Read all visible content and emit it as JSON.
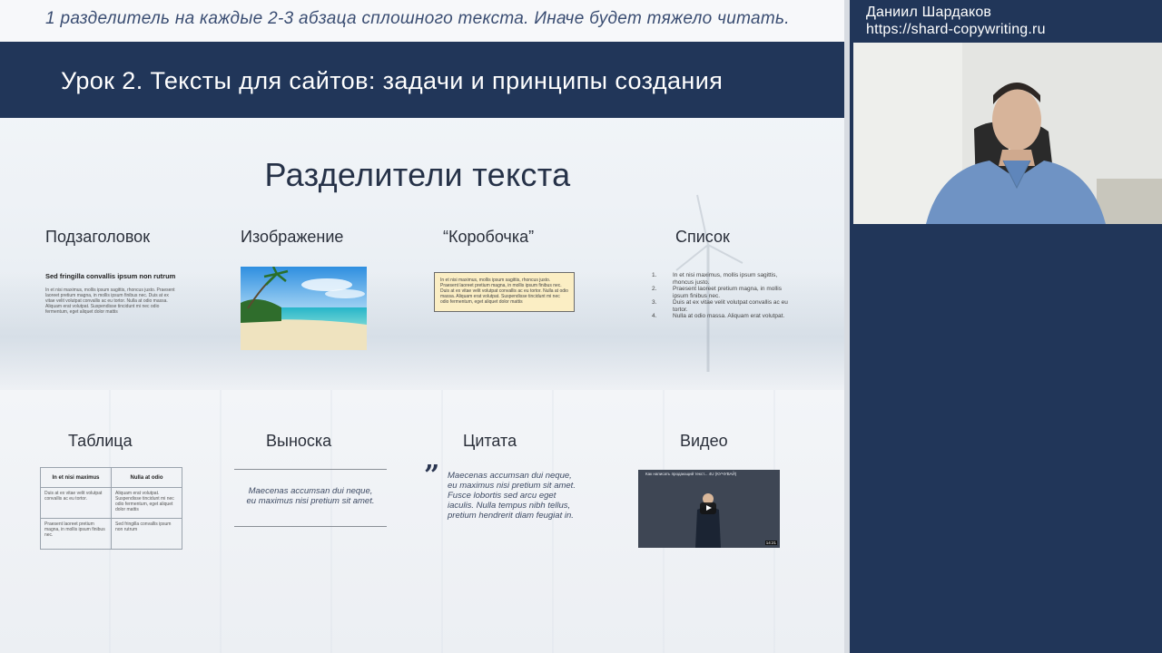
{
  "slide": {
    "top_note": "1 разделитель на каждые 2-3 абзаца сплошного текста. Иначе будет тяжело читать.",
    "lesson_title": "Урок 2. Тексты для сайтов: задачи и принципы создания",
    "heading": "Разделители текста",
    "labels": {
      "subheading": "Подзаголовок",
      "image": "Изображение",
      "box": "“Коробочка”",
      "list": "Список",
      "table": "Таблица",
      "callout": "Выноска",
      "quote": "Цитата",
      "video": "Видео"
    },
    "subheading_sample": {
      "title": "Sed fringilla convallis ipsum non rutrum",
      "body": "In et nisi maximus, mollis ipsum sagittis, rhoncus justo. Praesent laoreet pretium magna, in mollis ipsum finibus nec. Duis at ex vitae velit volutpat convallis ac eu tortor. Nulla at odio massa. Aliquam erat volutpat. Suspendisse tincidunt mi nec odio fermentum, eget aliquet dolor mattis"
    },
    "box_sample": {
      "text": "In et nisi maximus, mollis ipsum sagittis, rhoncus justo. Praesent laoreet pretium magna, in mollis ipsum finibus nec. Duis at ex vitae velit volutpat convallis ac eu tortor. Nulla at odio massa. Aliquam erat volutpat. Suspendisse tincidunt mi nec odio fermentum, eget aliquet dolor mattis"
    },
    "list_sample": [
      {
        "num": "1.",
        "text": "In et nisi maximus, mollis ipsum sagittis, rhoncus justo."
      },
      {
        "num": "2.",
        "text": "Praesent laoreet pretium magna, in mollis ipsum finibus nec."
      },
      {
        "num": "3.",
        "text": "Duis at ex vitae velit volutpat convallis ac eu tortor."
      },
      {
        "num": "4.",
        "text": "Nulla at odio massa. Aliquam erat volutpat."
      }
    ],
    "table_sample": {
      "headers": [
        "In et nisi maximus",
        "Nulla at odio"
      ],
      "rows": [
        [
          "Duis at ex vitae velit volutpat convallis ac eu tortor.",
          "Aliquam erat volutpat. Suspendisse tincidunt mi nec odio fermentum, eget aliquet dolor mattis"
        ],
        [
          "Praesent laoreet pretium magna, in mollis ipsum finibus nec.",
          "Sed fringilla convallis ipsum non rutrum"
        ]
      ]
    },
    "callout_sample": {
      "line1": "Maecenas accumsan dui neque,",
      "line2": "eu maximus nisi pretium sit amet."
    },
    "quote_sample": {
      "mark": "”",
      "lines": [
        "Maecenas accumsan dui neque,",
        "eu maximus nisi pretium sit amet.",
        "Fusce lobortis sed arcu eget",
        "iaculis. Nulla tempus nibh tellus,",
        "pretium hendrerit diam feugiat in."
      ]
    },
    "video_sample": {
      "title": "Как написать продающий текст... 4U (КУЧУВАЙ)",
      "duration": "14:21"
    }
  },
  "presenter": {
    "name": "Даниил Шардаков",
    "url": "https://shard-copywriting.ru"
  },
  "colors": {
    "title_bar": "#213659",
    "right_panel": "#213659",
    "box_fill": "#fbeec4",
    "note_text": "#3a4d72"
  }
}
